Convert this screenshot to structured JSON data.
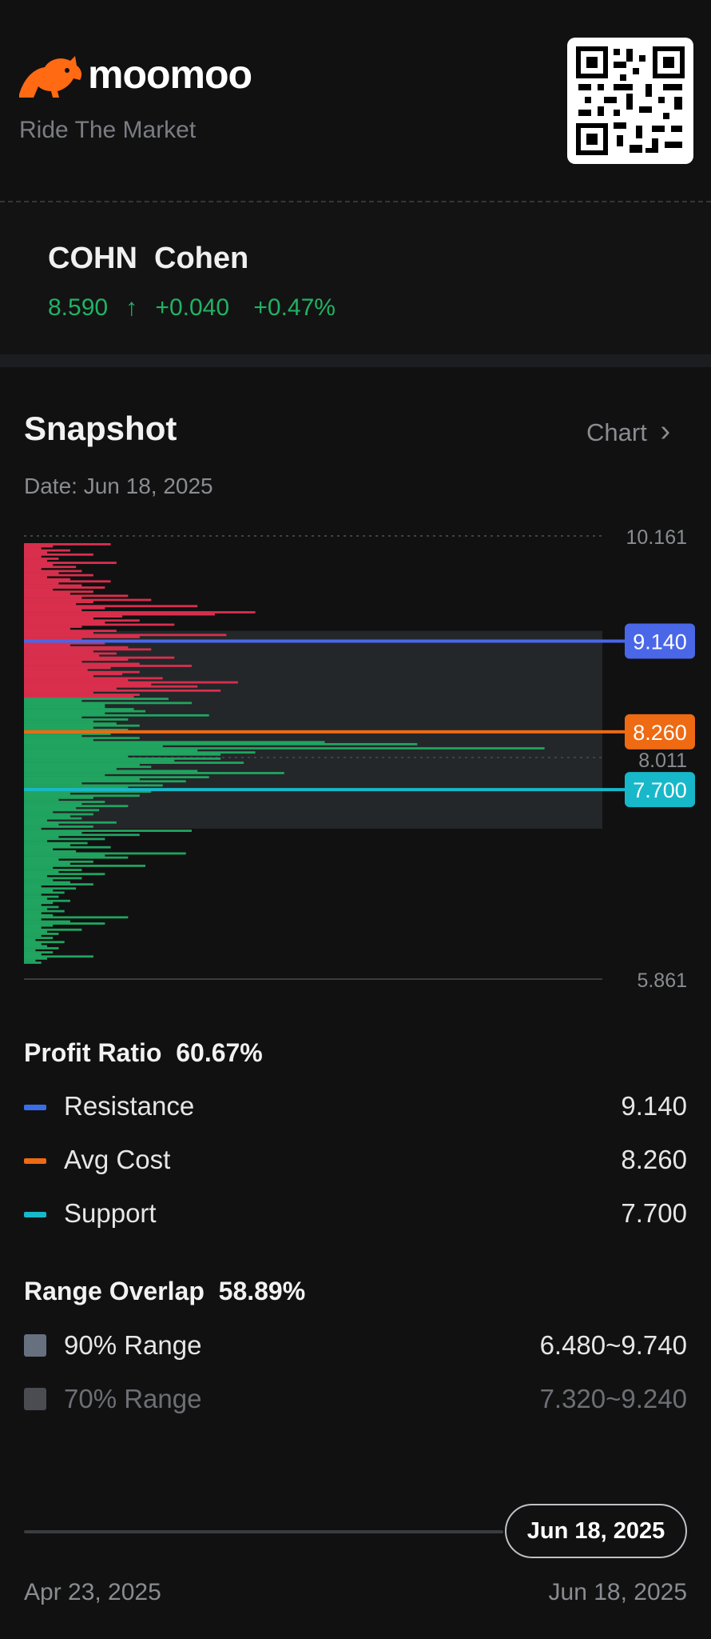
{
  "brand": {
    "name": "moomoo",
    "tagline": "Ride The Market",
    "logo_icon": "bull-icon",
    "qr_icon": "qr-code-icon",
    "accent": "#ff6a13"
  },
  "quote": {
    "symbol": "COHN",
    "name": "Cohen",
    "price": "8.590",
    "price_arrow": "↑",
    "change": "+0.040",
    "change_pct": "+0.47%",
    "up_color": "#20b362"
  },
  "snapshot": {
    "title": "Snapshot",
    "chart_link": "Chart",
    "chart_chevron": "›",
    "date": "Date: Jun 18, 2025"
  },
  "chart_data": {
    "type": "bar",
    "orientation": "horizontal",
    "y_ticks": [
      "10.161",
      "8.011",
      "5.861"
    ],
    "ylim": [
      5.861,
      10.161
    ],
    "markers": [
      {
        "label": "9.140",
        "value": 9.14,
        "color": "#4a67e8"
      },
      {
        "label": "8.260",
        "value": 8.26,
        "color": "#ee6a13"
      },
      {
        "label": "7.700",
        "value": 7.7,
        "color": "#17b8c9"
      }
    ],
    "range_90": [
      6.48,
      9.74
    ],
    "range_70": [
      7.32,
      9.24
    ],
    "profit_color": "#20a45f",
    "loss_color": "#d92f4d",
    "bars": [
      [
        10.08,
        0.15
      ],
      [
        10.06,
        0.05
      ],
      [
        10.04,
        0.03
      ],
      [
        10.02,
        0.08
      ],
      [
        10.0,
        0.04
      ],
      [
        9.98,
        0.12
      ],
      [
        9.96,
        0.03
      ],
      [
        9.94,
        0.06
      ],
      [
        9.92,
        0.04
      ],
      [
        9.9,
        0.16
      ],
      [
        9.88,
        0.05
      ],
      [
        9.86,
        0.09
      ],
      [
        9.84,
        0.03
      ],
      [
        9.82,
        0.1
      ],
      [
        9.8,
        0.06
      ],
      [
        9.78,
        0.12
      ],
      [
        9.76,
        0.04
      ],
      [
        9.74,
        0.08
      ],
      [
        9.72,
        0.15
      ],
      [
        9.7,
        0.06
      ],
      [
        9.68,
        0.1
      ],
      [
        9.66,
        0.14
      ],
      [
        9.64,
        0.05
      ],
      [
        9.62,
        0.12
      ],
      [
        9.6,
        0.08
      ],
      [
        9.58,
        0.18
      ],
      [
        9.56,
        0.1
      ],
      [
        9.54,
        0.22
      ],
      [
        9.52,
        0.12
      ],
      [
        9.5,
        0.09
      ],
      [
        9.48,
        0.3
      ],
      [
        9.46,
        0.14
      ],
      [
        9.44,
        0.1
      ],
      [
        9.42,
        0.4
      ],
      [
        9.4,
        0.33
      ],
      [
        9.38,
        0.17
      ],
      [
        9.36,
        0.12
      ],
      [
        9.34,
        0.2
      ],
      [
        9.32,
        0.14
      ],
      [
        9.3,
        0.26
      ],
      [
        9.28,
        0.1
      ],
      [
        9.26,
        0.08
      ],
      [
        9.24,
        0.16
      ],
      [
        9.22,
        0.12
      ],
      [
        9.2,
        0.35
      ],
      [
        9.18,
        0.2
      ],
      [
        9.16,
        0.1
      ],
      [
        9.14,
        0.15
      ],
      [
        9.12,
        0.14
      ],
      [
        9.1,
        0.08
      ],
      [
        9.08,
        0.18
      ],
      [
        9.06,
        0.22
      ],
      [
        9.04,
        0.12
      ],
      [
        9.02,
        0.16
      ],
      [
        9.0,
        0.13
      ],
      [
        8.98,
        0.26
      ],
      [
        8.96,
        0.18
      ],
      [
        8.94,
        0.1
      ],
      [
        8.92,
        0.2
      ],
      [
        8.9,
        0.29
      ],
      [
        8.88,
        0.15
      ],
      [
        8.86,
        0.11
      ],
      [
        8.84,
        0.2
      ],
      [
        8.82,
        0.17
      ],
      [
        8.8,
        0.12
      ],
      [
        8.78,
        0.24
      ],
      [
        8.76,
        0.18
      ],
      [
        8.74,
        0.37
      ],
      [
        8.72,
        0.22
      ],
      [
        8.7,
        0.3
      ],
      [
        8.68,
        0.16
      ],
      [
        8.66,
        0.34
      ],
      [
        8.64,
        0.12
      ],
      [
        8.62,
        0.2
      ],
      [
        8.6,
        0.19
      ],
      [
        8.58,
        0.25
      ],
      [
        8.56,
        0.1
      ],
      [
        8.54,
        0.29
      ],
      [
        8.52,
        0.14
      ],
      [
        8.5,
        0.14
      ],
      [
        8.48,
        0.19
      ],
      [
        8.46,
        0.21
      ],
      [
        8.44,
        0.14
      ],
      [
        8.42,
        0.32
      ],
      [
        8.4,
        0.1
      ],
      [
        8.38,
        0.18
      ],
      [
        8.36,
        0.12
      ],
      [
        8.34,
        0.16
      ],
      [
        8.32,
        0.2
      ],
      [
        8.3,
        0.12
      ],
      [
        8.28,
        0.18
      ],
      [
        8.26,
        0.27
      ],
      [
        8.24,
        0.15
      ],
      [
        8.22,
        0.1
      ],
      [
        8.2,
        0.2
      ],
      [
        8.18,
        0.12
      ],
      [
        8.16,
        0.52
      ],
      [
        8.14,
        0.68
      ],
      [
        8.12,
        0.24
      ],
      [
        8.1,
        0.9
      ],
      [
        8.08,
        0.3
      ],
      [
        8.06,
        0.4
      ],
      [
        8.04,
        0.34
      ],
      [
        8.02,
        0.18
      ],
      [
        8.0,
        0.34
      ],
      [
        7.98,
        0.26
      ],
      [
        7.96,
        0.38
      ],
      [
        7.94,
        0.2
      ],
      [
        7.92,
        0.22
      ],
      [
        7.9,
        0.16
      ],
      [
        7.88,
        0.3
      ],
      [
        7.86,
        0.45
      ],
      [
        7.84,
        0.14
      ],
      [
        7.82,
        0.32
      ],
      [
        7.8,
        0.2
      ],
      [
        7.78,
        0.28
      ],
      [
        7.76,
        0.1
      ],
      [
        7.74,
        0.24
      ],
      [
        7.72,
        0.18
      ],
      [
        7.7,
        0.12
      ],
      [
        7.68,
        0.22
      ],
      [
        7.66,
        0.08
      ],
      [
        7.64,
        0.2
      ],
      [
        7.62,
        0.12
      ],
      [
        7.6,
        0.06
      ],
      [
        7.58,
        0.14
      ],
      [
        7.56,
        0.1
      ],
      [
        7.54,
        0.18
      ],
      [
        7.52,
        0.09
      ],
      [
        7.5,
        0.13
      ],
      [
        7.48,
        0.05
      ],
      [
        7.46,
        0.12
      ],
      [
        7.44,
        0.08
      ],
      [
        7.42,
        0.1
      ],
      [
        7.4,
        0.04
      ],
      [
        7.38,
        0.16
      ],
      [
        7.36,
        0.06
      ],
      [
        7.34,
        0.12
      ],
      [
        7.32,
        0.03
      ],
      [
        7.3,
        0.29
      ],
      [
        7.28,
        0.1
      ],
      [
        7.26,
        0.2
      ],
      [
        7.24,
        0.06
      ],
      [
        7.22,
        0.14
      ],
      [
        7.2,
        0.04
      ],
      [
        7.18,
        0.11
      ],
      [
        7.16,
        0.08
      ],
      [
        7.14,
        0.15
      ],
      [
        7.12,
        0.05
      ],
      [
        7.1,
        0.09
      ],
      [
        7.08,
        0.28
      ],
      [
        7.06,
        0.14
      ],
      [
        7.04,
        0.18
      ],
      [
        7.02,
        0.06
      ],
      [
        7.0,
        0.12
      ],
      [
        6.98,
        0.08
      ],
      [
        6.96,
        0.21
      ],
      [
        6.94,
        0.05
      ],
      [
        6.92,
        0.1
      ],
      [
        6.9,
        0.06
      ],
      [
        6.88,
        0.14
      ],
      [
        6.86,
        0.04
      ],
      [
        6.84,
        0.1
      ],
      [
        6.82,
        0.05
      ],
      [
        6.8,
        0.08
      ],
      [
        6.78,
        0.12
      ],
      [
        6.76,
        0.03
      ],
      [
        6.74,
        0.09
      ],
      [
        6.72,
        0.05
      ],
      [
        6.7,
        0.07
      ],
      [
        6.68,
        0.03
      ],
      [
        6.66,
        0.06
      ],
      [
        6.64,
        0.04
      ],
      [
        6.62,
        0.08
      ],
      [
        6.6,
        0.05
      ],
      [
        6.58,
        0.03
      ],
      [
        6.56,
        0.06
      ],
      [
        6.54,
        0.04
      ],
      [
        6.52,
        0.07
      ],
      [
        6.5,
        0.03
      ],
      [
        6.48,
        0.05
      ],
      [
        6.46,
        0.18
      ],
      [
        6.44,
        0.03
      ],
      [
        6.42,
        0.08
      ],
      [
        6.4,
        0.14
      ],
      [
        6.38,
        0.05
      ],
      [
        6.36,
        0.03
      ],
      [
        6.34,
        0.1
      ],
      [
        6.32,
        0.04
      ],
      [
        6.3,
        0.06
      ],
      [
        6.28,
        0.03
      ],
      [
        6.26,
        0.05
      ],
      [
        6.24,
        0.02
      ],
      [
        6.22,
        0.07
      ],
      [
        6.2,
        0.03
      ],
      [
        6.18,
        0.04
      ],
      [
        6.16,
        0.06
      ],
      [
        6.14,
        0.02
      ],
      [
        6.12,
        0.05
      ],
      [
        6.1,
        0.03
      ],
      [
        6.08,
        0.12
      ],
      [
        6.06,
        0.04
      ],
      [
        6.04,
        0.02
      ],
      [
        6.02,
        0.03
      ]
    ]
  },
  "profit": {
    "label": "Profit Ratio",
    "value": "60.67%"
  },
  "levels": [
    {
      "label": "Resistance",
      "value": "9.140",
      "color": "#3a6ee8"
    },
    {
      "label": "Avg Cost",
      "value": "8.260",
      "color": "#ee6a13"
    },
    {
      "label": "Support",
      "value": "7.700",
      "color": "#17b8c9"
    }
  ],
  "overlap": {
    "label": "Range Overlap",
    "value": "58.89%"
  },
  "ranges": [
    {
      "label": "90% Range",
      "value": "6.480~9.740",
      "color": "#67707f"
    },
    {
      "label": "70% Range",
      "value": "7.320~9.240",
      "color": "#4a4c51"
    }
  ],
  "timeline": {
    "selected": "Jun 18, 2025",
    "start": "Apr 23, 2025",
    "end": "Jun 18, 2025"
  }
}
